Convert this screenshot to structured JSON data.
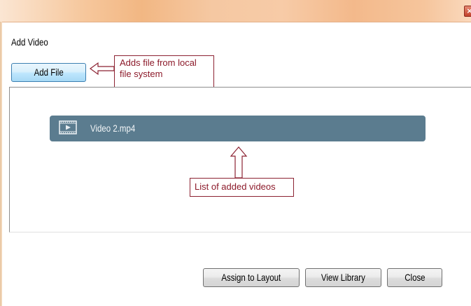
{
  "window": {
    "close_glyph": "×"
  },
  "dialog": {
    "title": "Add Video",
    "add_file_label": "Add File"
  },
  "videos": [
    {
      "label": "Video 2.mp4",
      "icon": "video-play-icon"
    }
  ],
  "annotations": {
    "add_file_note_line1": "Adds file from local",
    "add_file_note_line2": "file system",
    "list_note": "List of added videos"
  },
  "footer": {
    "assign_label": "Assign to Layout",
    "library_label": "View Library",
    "close_label": "Close"
  },
  "colors": {
    "video_item_bg": "#5b7c8f",
    "callout_border": "#8c2232",
    "callout_text": "#8c1a2a"
  }
}
